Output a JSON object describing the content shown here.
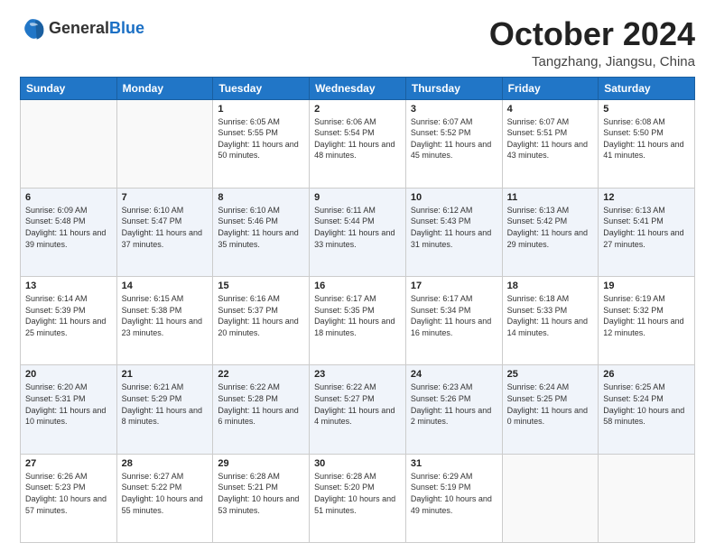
{
  "header": {
    "logo_general": "General",
    "logo_blue": "Blue",
    "month_title": "October 2024",
    "location": "Tangzhang, Jiangsu, China"
  },
  "weekdays": [
    "Sunday",
    "Monday",
    "Tuesday",
    "Wednesday",
    "Thursday",
    "Friday",
    "Saturday"
  ],
  "weeks": [
    [
      {
        "day": "",
        "info": ""
      },
      {
        "day": "",
        "info": ""
      },
      {
        "day": "1",
        "info": "Sunrise: 6:05 AM\nSunset: 5:55 PM\nDaylight: 11 hours and 50 minutes."
      },
      {
        "day": "2",
        "info": "Sunrise: 6:06 AM\nSunset: 5:54 PM\nDaylight: 11 hours and 48 minutes."
      },
      {
        "day": "3",
        "info": "Sunrise: 6:07 AM\nSunset: 5:52 PM\nDaylight: 11 hours and 45 minutes."
      },
      {
        "day": "4",
        "info": "Sunrise: 6:07 AM\nSunset: 5:51 PM\nDaylight: 11 hours and 43 minutes."
      },
      {
        "day": "5",
        "info": "Sunrise: 6:08 AM\nSunset: 5:50 PM\nDaylight: 11 hours and 41 minutes."
      }
    ],
    [
      {
        "day": "6",
        "info": "Sunrise: 6:09 AM\nSunset: 5:48 PM\nDaylight: 11 hours and 39 minutes."
      },
      {
        "day": "7",
        "info": "Sunrise: 6:10 AM\nSunset: 5:47 PM\nDaylight: 11 hours and 37 minutes."
      },
      {
        "day": "8",
        "info": "Sunrise: 6:10 AM\nSunset: 5:46 PM\nDaylight: 11 hours and 35 minutes."
      },
      {
        "day": "9",
        "info": "Sunrise: 6:11 AM\nSunset: 5:44 PM\nDaylight: 11 hours and 33 minutes."
      },
      {
        "day": "10",
        "info": "Sunrise: 6:12 AM\nSunset: 5:43 PM\nDaylight: 11 hours and 31 minutes."
      },
      {
        "day": "11",
        "info": "Sunrise: 6:13 AM\nSunset: 5:42 PM\nDaylight: 11 hours and 29 minutes."
      },
      {
        "day": "12",
        "info": "Sunrise: 6:13 AM\nSunset: 5:41 PM\nDaylight: 11 hours and 27 minutes."
      }
    ],
    [
      {
        "day": "13",
        "info": "Sunrise: 6:14 AM\nSunset: 5:39 PM\nDaylight: 11 hours and 25 minutes."
      },
      {
        "day": "14",
        "info": "Sunrise: 6:15 AM\nSunset: 5:38 PM\nDaylight: 11 hours and 23 minutes."
      },
      {
        "day": "15",
        "info": "Sunrise: 6:16 AM\nSunset: 5:37 PM\nDaylight: 11 hours and 20 minutes."
      },
      {
        "day": "16",
        "info": "Sunrise: 6:17 AM\nSunset: 5:35 PM\nDaylight: 11 hours and 18 minutes."
      },
      {
        "day": "17",
        "info": "Sunrise: 6:17 AM\nSunset: 5:34 PM\nDaylight: 11 hours and 16 minutes."
      },
      {
        "day": "18",
        "info": "Sunrise: 6:18 AM\nSunset: 5:33 PM\nDaylight: 11 hours and 14 minutes."
      },
      {
        "day": "19",
        "info": "Sunrise: 6:19 AM\nSunset: 5:32 PM\nDaylight: 11 hours and 12 minutes."
      }
    ],
    [
      {
        "day": "20",
        "info": "Sunrise: 6:20 AM\nSunset: 5:31 PM\nDaylight: 11 hours and 10 minutes."
      },
      {
        "day": "21",
        "info": "Sunrise: 6:21 AM\nSunset: 5:29 PM\nDaylight: 11 hours and 8 minutes."
      },
      {
        "day": "22",
        "info": "Sunrise: 6:22 AM\nSunset: 5:28 PM\nDaylight: 11 hours and 6 minutes."
      },
      {
        "day": "23",
        "info": "Sunrise: 6:22 AM\nSunset: 5:27 PM\nDaylight: 11 hours and 4 minutes."
      },
      {
        "day": "24",
        "info": "Sunrise: 6:23 AM\nSunset: 5:26 PM\nDaylight: 11 hours and 2 minutes."
      },
      {
        "day": "25",
        "info": "Sunrise: 6:24 AM\nSunset: 5:25 PM\nDaylight: 11 hours and 0 minutes."
      },
      {
        "day": "26",
        "info": "Sunrise: 6:25 AM\nSunset: 5:24 PM\nDaylight: 10 hours and 58 minutes."
      }
    ],
    [
      {
        "day": "27",
        "info": "Sunrise: 6:26 AM\nSunset: 5:23 PM\nDaylight: 10 hours and 57 minutes."
      },
      {
        "day": "28",
        "info": "Sunrise: 6:27 AM\nSunset: 5:22 PM\nDaylight: 10 hours and 55 minutes."
      },
      {
        "day": "29",
        "info": "Sunrise: 6:28 AM\nSunset: 5:21 PM\nDaylight: 10 hours and 53 minutes."
      },
      {
        "day": "30",
        "info": "Sunrise: 6:28 AM\nSunset: 5:20 PM\nDaylight: 10 hours and 51 minutes."
      },
      {
        "day": "31",
        "info": "Sunrise: 6:29 AM\nSunset: 5:19 PM\nDaylight: 10 hours and 49 minutes."
      },
      {
        "day": "",
        "info": ""
      },
      {
        "day": "",
        "info": ""
      }
    ]
  ]
}
